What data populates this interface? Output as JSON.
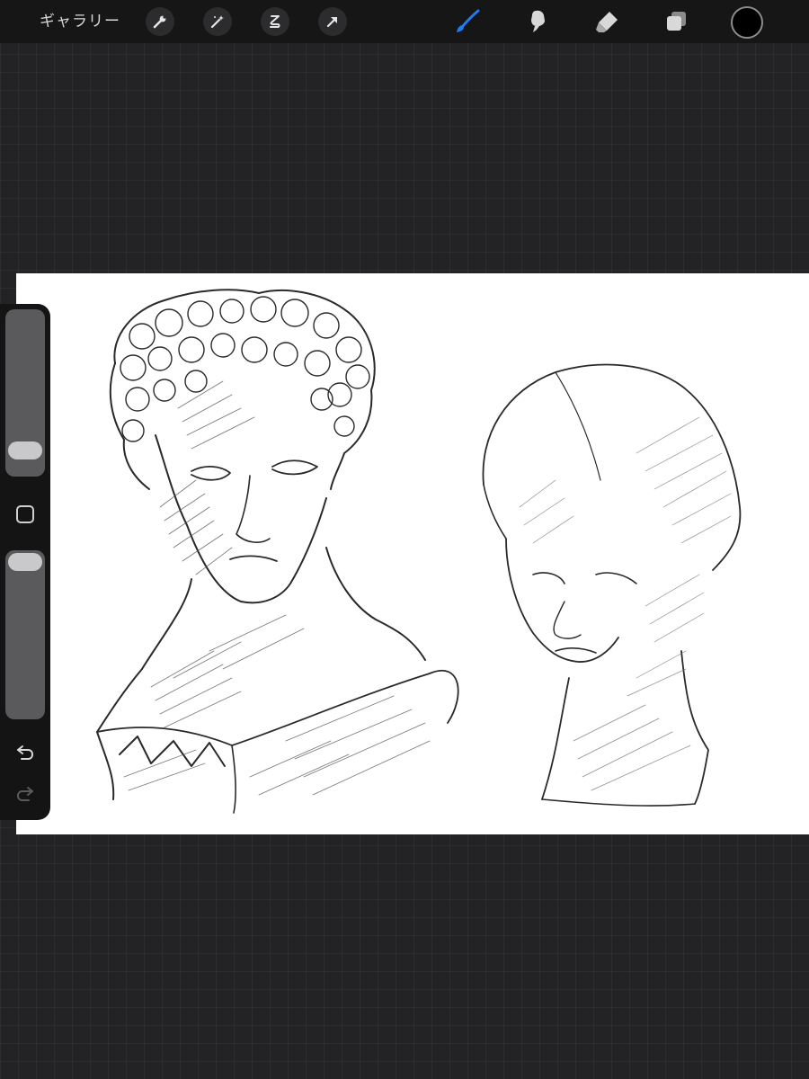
{
  "topbar": {
    "gallery_label": "ギャラリー",
    "left_tools": [
      {
        "name": "actions",
        "icon": "wrench-icon"
      },
      {
        "name": "adjustments",
        "icon": "magic-wand-icon"
      },
      {
        "name": "selection",
        "icon": "selection-s-icon"
      },
      {
        "name": "transform",
        "icon": "arrow-cursor-icon"
      }
    ],
    "right_tools": [
      {
        "name": "brush",
        "icon": "brush-icon",
        "active": true
      },
      {
        "name": "smudge",
        "icon": "smudge-icon",
        "active": false
      },
      {
        "name": "eraser",
        "icon": "eraser-icon",
        "active": false
      },
      {
        "name": "layers",
        "icon": "layers-icon",
        "active": false
      }
    ],
    "current_color": "#000000",
    "accent_color": "#1f7cf5"
  },
  "sidebar": {
    "brush_size_level": 0.1,
    "opacity_level": 1.0,
    "modify_icon": "square-icon",
    "undo_icon": "undo-icon",
    "redo_icon": "redo-icon",
    "redo_enabled": false
  },
  "canvas": {
    "background": "#ffffff",
    "content": "pencil-sketch-two-busts"
  }
}
